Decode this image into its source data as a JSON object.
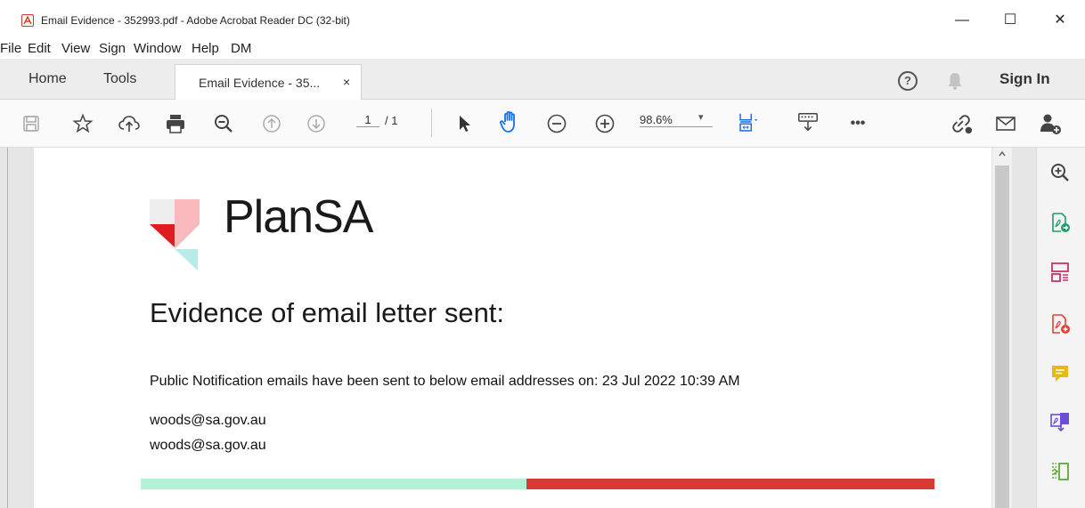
{
  "window": {
    "title": "Email Evidence - 352993.pdf - Adobe Acrobat Reader DC (32-bit)",
    "minimize": "—",
    "maximize": "☐",
    "close": "✕"
  },
  "menu": [
    "File",
    "Edit",
    "View",
    "Sign",
    "Window",
    "Help",
    "DM"
  ],
  "tabs": {
    "home": "Home",
    "tools": "Tools",
    "document": "Email Evidence - 35...",
    "document_close": "×"
  },
  "header": {
    "help": "?",
    "sign_in": "Sign In"
  },
  "toolbar": {
    "page_current": "1",
    "page_total": "/ 1",
    "zoom": "98.6%",
    "zoom_arrow": "▾",
    "more": "•••"
  },
  "document": {
    "logo_text": "PlanSA",
    "heading": "Evidence of email letter sent:",
    "notice": "Public Notification emails have been sent to below email addresses on: 23 Jul 2022  10:39 AM",
    "emails": [
      "woods@sa.gov.au",
      "woods@sa.gov.au"
    ]
  },
  "colors": {
    "accent_blue": "#1473e6",
    "bar_green": "#b4f2d6",
    "bar_red": "#d63a32"
  }
}
